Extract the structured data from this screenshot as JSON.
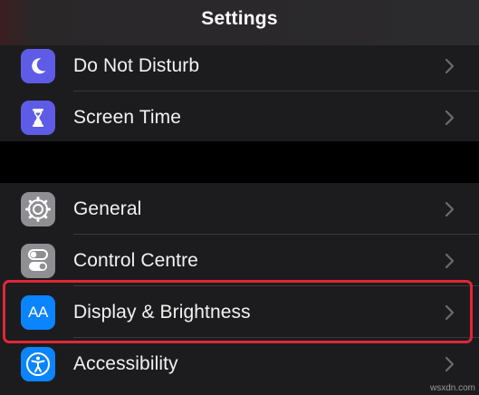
{
  "header": {
    "title": "Settings"
  },
  "group1": [
    {
      "label": "Do Not Disturb",
      "icon": "moon-icon",
      "color": "#5e5ce6"
    },
    {
      "label": "Screen Time",
      "icon": "hourglass-icon",
      "color": "#5e5ce6"
    }
  ],
  "group2": [
    {
      "label": "General",
      "icon": "gear-icon",
      "color": "#8e8e93"
    },
    {
      "label": "Control Centre",
      "icon": "toggles-icon",
      "color": "#8e8e93"
    },
    {
      "label": "Display & Brightness",
      "icon": "text-size-icon",
      "color": "#0a84ff",
      "icon_text": "AA",
      "highlighted": true
    },
    {
      "label": "Accessibility",
      "icon": "accessibility-icon",
      "color": "#0a84ff"
    }
  ],
  "watermark": "wsxdn.com"
}
